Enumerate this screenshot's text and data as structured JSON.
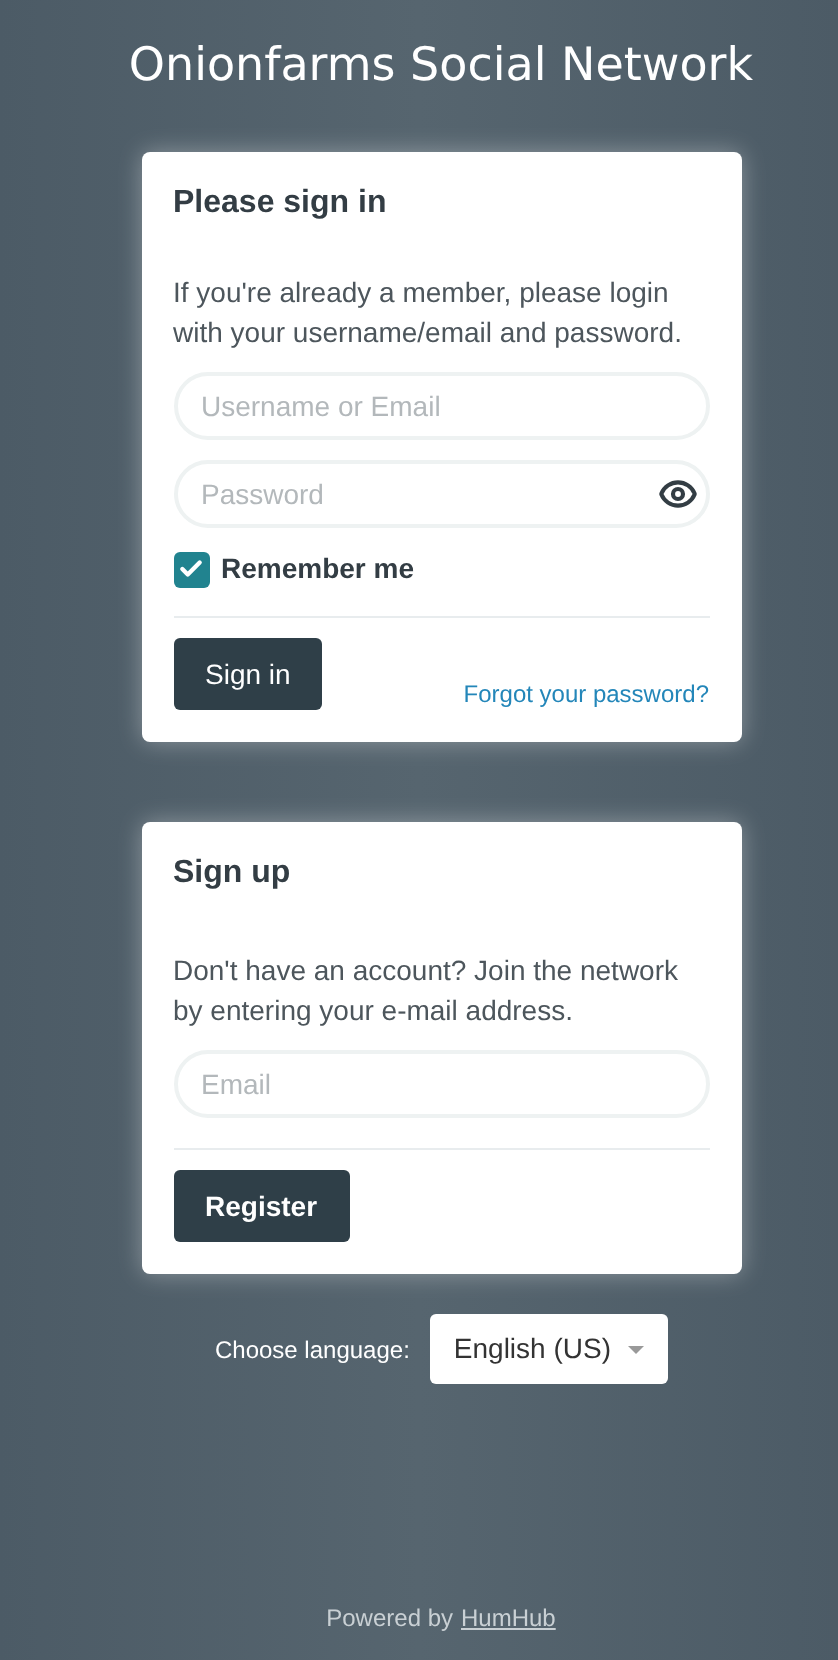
{
  "site_title": "Onionfarms Social Network",
  "sign_in": {
    "heading": "Please sign in",
    "intro": "If you're already a member, please login with your username/email and password.",
    "username": {
      "placeholder": "Username or Email"
    },
    "password": {
      "placeholder": "Password"
    },
    "remember": {
      "label": "Remember me",
      "checked": true
    },
    "submit": "Sign in",
    "forgot": "Forgot your password?"
  },
  "sign_up": {
    "heading": "Sign up",
    "intro": "Don't have an account? Join the network by entering your e-mail address.",
    "email": {
      "placeholder": "Email"
    },
    "submit": "Register"
  },
  "language": {
    "label": "Choose language:",
    "value": "English (US)"
  },
  "footer": {
    "text": "Powered by",
    "link": "HumHub"
  }
}
